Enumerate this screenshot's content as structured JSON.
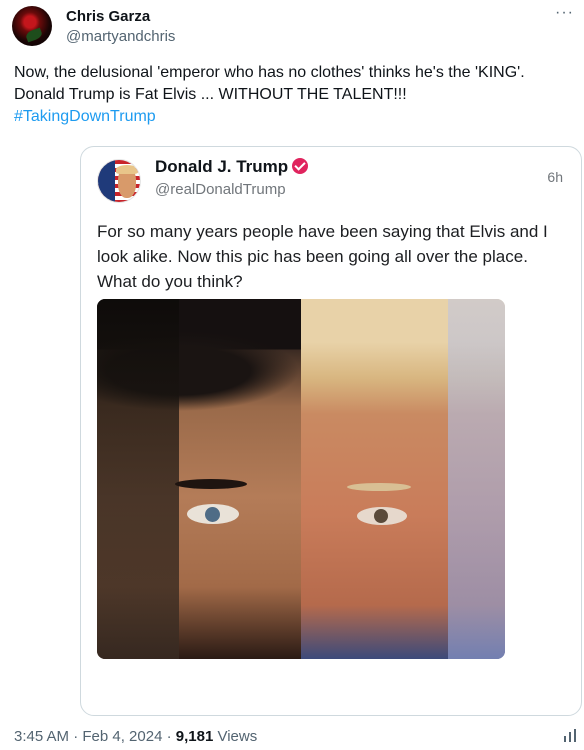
{
  "author": {
    "name": "Chris Garza",
    "handle": "@martyandchris"
  },
  "more_label": "···",
  "tweet": {
    "line1": "Now, the delusional 'emperor who has no clothes' thinks he's the 'KING'.",
    "line2": "Donald Trump is Fat Elvis ... WITHOUT THE TALENT!!!",
    "hashtag": "#TakingDownTrump"
  },
  "quoted": {
    "name": "Donald J. Trump",
    "handle": "@realDonaldTrump",
    "time": "6h",
    "text": "For so many years people have been saying that Elvis and I look alike. Now this pic has been going all over the place. What do you think?"
  },
  "meta": {
    "time_date": "3:45 AM · Feb 4, 2024 · ",
    "views_count": "9,181",
    "views_label": " Views"
  },
  "icons": {
    "verified": "verified-badge-icon",
    "stats": "stats-icon"
  },
  "colors": {
    "link": "#1d9bf0",
    "verified": "#e0245e",
    "secondary_text": "#536471"
  }
}
